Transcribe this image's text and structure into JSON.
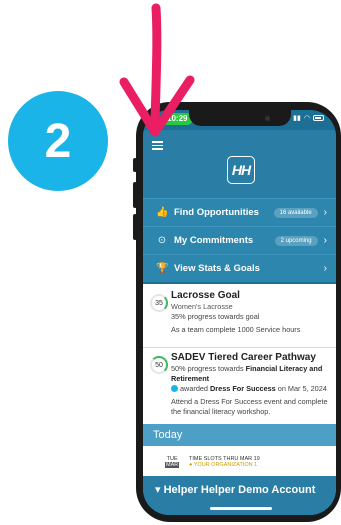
{
  "step": {
    "number": "2"
  },
  "status_bar": {
    "time": "10:29"
  },
  "menu": [
    {
      "label": "Find Opportunities",
      "badge": "16 available",
      "icon": "thumbs-up-icon"
    },
    {
      "label": "My Commitments",
      "badge": "2 upcoming",
      "icon": "location-pin-icon"
    },
    {
      "label": "View Stats & Goals",
      "badge": "",
      "icon": "trophy-icon"
    }
  ],
  "goal_card": {
    "progress": "35",
    "title": "Lacrosse Goal",
    "subtitle": "Women's Lacrosse",
    "progress_text": "35% progress towards goal",
    "description": "As a team complete 1000 Service hours"
  },
  "pathway_card": {
    "progress": "50",
    "title": "SADEV Tiered Career Pathway",
    "progress_prefix": "50% progress towards ",
    "progress_target": "Financial Literacy and Retirement",
    "award_prefix": "awarded ",
    "award_name": "Dress For Success",
    "award_suffix": " on Mar 5, 2024",
    "description": "Attend a Dress For Success event and complete the financial literacy workshop."
  },
  "today": {
    "label": "Today",
    "slot_day": "TUE",
    "slot_date": "MAR",
    "slot_title": "TIME SLOTS THRU MAR 19",
    "slot_org": "YOUR ORGANIZATION 1"
  },
  "account": {
    "label": "▾ Helper Helper Demo Account"
  },
  "colors": {
    "accent": "#1ab4e8",
    "arrow": "#e91e63",
    "header": "#2a7ea5",
    "progress": "#3dbb5a"
  }
}
